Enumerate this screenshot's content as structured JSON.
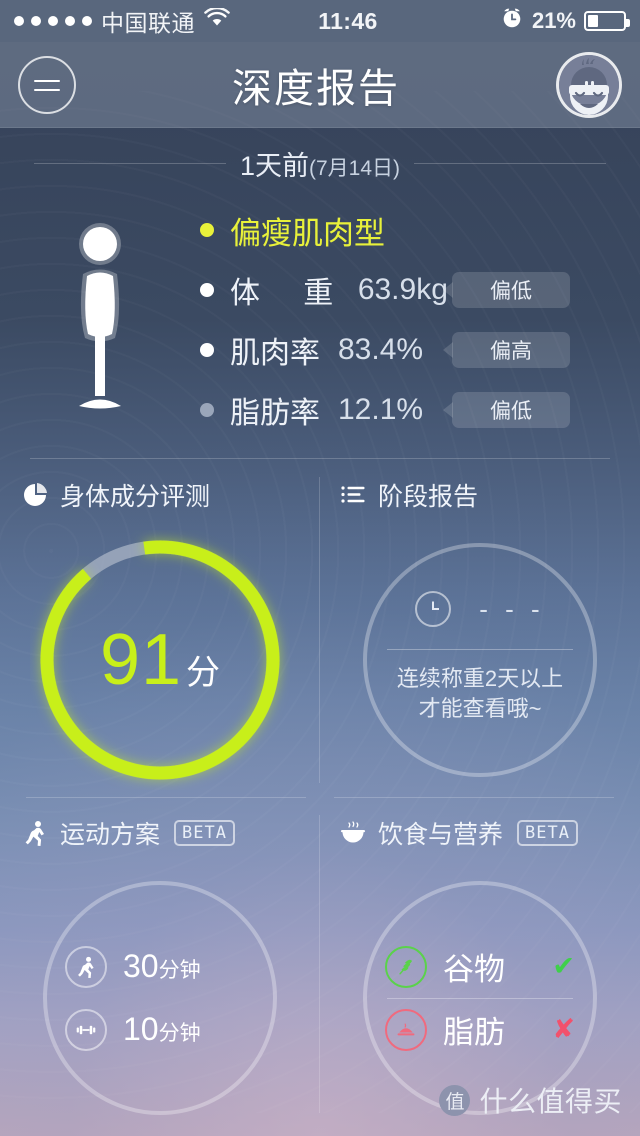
{
  "status_bar": {
    "signal_dots": 5,
    "carrier": "中国联通",
    "wifi_icon": "wifi-icon",
    "time": "11:46",
    "alarm_icon": "alarm-clock-icon",
    "battery_percent": "21%",
    "battery_fill": 28
  },
  "nav": {
    "menu_icon": "hamburger-menu-icon",
    "title": "深度报告",
    "avatar_icon": "user-avatar-icon"
  },
  "summary": {
    "date_main": "1天前",
    "date_sub": "(7月14日)",
    "body_figure_icon": "body-silhouette-icon",
    "rows": [
      {
        "label": "偏瘦肌肉型",
        "value": "",
        "badge": "",
        "bullet_color": "#e8f13a",
        "highlight": true
      },
      {
        "label": "体　重",
        "value": "63.9kg",
        "badge": "偏低",
        "bullet_color": "#ffffff",
        "highlight": false
      },
      {
        "label": "肌肉率",
        "value": "83.4%",
        "badge": "偏高",
        "bullet_color": "#ffffff",
        "highlight": false
      },
      {
        "label": "脂肪率",
        "value": "12.1%",
        "badge": "偏低",
        "bullet_color": "#9aa6ba",
        "highlight": false
      }
    ]
  },
  "panels": {
    "body_composition": {
      "icon": "pie-chart-icon",
      "title": "身体成分评测",
      "score": "91",
      "score_unit": "分",
      "ring_percent": 91,
      "ring_color": "#c8ef1a",
      "ring_track_color": "#aab4c6"
    },
    "stage_report": {
      "icon": "list-lines-icon",
      "title": "阶段报告",
      "clock_icon": "clock-icon",
      "placeholder_value": "- - -",
      "note_line1": "连续称重2天以上",
      "note_line2": "才能查看哦~"
    },
    "exercise_plan": {
      "icon": "running-person-icon",
      "title": "运动方案",
      "beta": "BETA",
      "items": [
        {
          "icon": "running-person-icon",
          "value": "30",
          "unit": "分钟"
        },
        {
          "icon": "dumbbell-icon",
          "value": "10",
          "unit": "分钟"
        }
      ]
    },
    "diet_nutrition": {
      "icon": "bowl-steam-icon",
      "title": "饮食与营养",
      "beta": "BETA",
      "items": [
        {
          "icon": "grain-wheat-icon",
          "label": "谷物",
          "mark": "✔",
          "state": "ok",
          "color": "#3fd04a"
        },
        {
          "icon": "roast-meat-icon",
          "label": "脂肪",
          "mark": "✘",
          "state": "no",
          "color": "#f2516c"
        }
      ]
    }
  },
  "watermark": {
    "badge": "值",
    "text": "什么值得买"
  }
}
